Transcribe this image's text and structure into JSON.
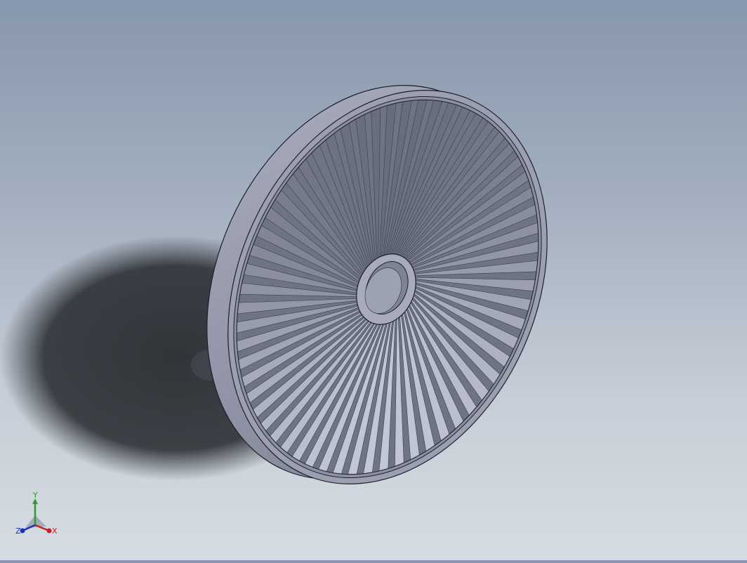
{
  "app": "3D CAD viewport",
  "model": {
    "part": "turbine-wheel",
    "blade_count": 60,
    "body_color": "#9a9fb1",
    "edge_color": "#1c1f2a"
  },
  "colors": {
    "background_top": "#8797ad",
    "background_bottom": "#d6dce2",
    "shadow": "#2a2c31"
  },
  "triad": {
    "x_label": "X",
    "y_label": "Y",
    "z_label": "Z",
    "x_color": "#c8202a",
    "y_color": "#2f9a2f",
    "z_color": "#1f2fb8"
  }
}
